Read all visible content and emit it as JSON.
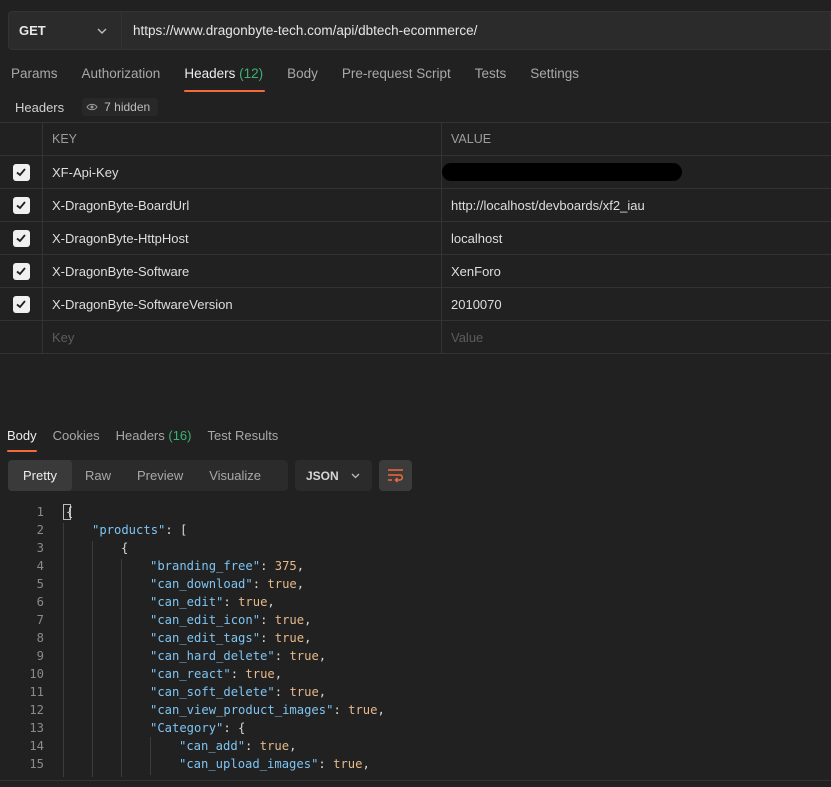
{
  "request": {
    "method": "GET",
    "url": "https://www.dragonbyte-tech.com/api/dbtech-ecommerce/"
  },
  "request_tabs": [
    {
      "label": "Params",
      "count": ""
    },
    {
      "label": "Authorization",
      "count": ""
    },
    {
      "label": "Headers",
      "count": "(12)"
    },
    {
      "label": "Body",
      "count": ""
    },
    {
      "label": "Pre-request Script",
      "count": ""
    },
    {
      "label": "Tests",
      "count": ""
    },
    {
      "label": "Settings",
      "count": ""
    }
  ],
  "headers_panel": {
    "label": "Headers",
    "hidden_label": "7 hidden",
    "col_key": "KEY",
    "col_value": "VALUE",
    "rows": [
      {
        "key": "XF-Api-Key",
        "value": ""
      },
      {
        "key": "X-DragonByte-BoardUrl",
        "value": "http://localhost/devboards/xf2_iau"
      },
      {
        "key": "X-DragonByte-HttpHost",
        "value": "localhost"
      },
      {
        "key": "X-DragonByte-Software",
        "value": "XenForo"
      },
      {
        "key": "X-DragonByte-SoftwareVersion",
        "value": "2010070"
      }
    ],
    "placeholder_key": "Key",
    "placeholder_value": "Value"
  },
  "response_tabs": [
    {
      "label": "Body",
      "count": ""
    },
    {
      "label": "Cookies",
      "count": ""
    },
    {
      "label": "Headers",
      "count": "(16)"
    },
    {
      "label": "Test Results",
      "count": ""
    }
  ],
  "view_modes": [
    "Pretty",
    "Raw",
    "Preview",
    "Visualize"
  ],
  "format": "JSON",
  "code_lines": [
    {
      "n": "1",
      "indent": 0,
      "parts": [
        [
          "p",
          "{"
        ]
      ]
    },
    {
      "n": "2",
      "indent": 1,
      "parts": [
        [
          "k",
          "\"products\""
        ],
        [
          "p",
          ": ["
        ]
      ]
    },
    {
      "n": "3",
      "indent": 2,
      "parts": [
        [
          "p",
          "{"
        ]
      ]
    },
    {
      "n": "4",
      "indent": 3,
      "parts": [
        [
          "k",
          "\"branding_free\""
        ],
        [
          "p",
          ": "
        ],
        [
          "v",
          "375"
        ],
        [
          "p",
          ","
        ]
      ]
    },
    {
      "n": "5",
      "indent": 3,
      "parts": [
        [
          "k",
          "\"can_download\""
        ],
        [
          "p",
          ": "
        ],
        [
          "v",
          "true"
        ],
        [
          "p",
          ","
        ]
      ]
    },
    {
      "n": "6",
      "indent": 3,
      "parts": [
        [
          "k",
          "\"can_edit\""
        ],
        [
          "p",
          ": "
        ],
        [
          "v",
          "true"
        ],
        [
          "p",
          ","
        ]
      ]
    },
    {
      "n": "7",
      "indent": 3,
      "parts": [
        [
          "k",
          "\"can_edit_icon\""
        ],
        [
          "p",
          ": "
        ],
        [
          "v",
          "true"
        ],
        [
          "p",
          ","
        ]
      ]
    },
    {
      "n": "8",
      "indent": 3,
      "parts": [
        [
          "k",
          "\"can_edit_tags\""
        ],
        [
          "p",
          ": "
        ],
        [
          "v",
          "true"
        ],
        [
          "p",
          ","
        ]
      ]
    },
    {
      "n": "9",
      "indent": 3,
      "parts": [
        [
          "k",
          "\"can_hard_delete\""
        ],
        [
          "p",
          ": "
        ],
        [
          "v",
          "true"
        ],
        [
          "p",
          ","
        ]
      ]
    },
    {
      "n": "10",
      "indent": 3,
      "parts": [
        [
          "k",
          "\"can_react\""
        ],
        [
          "p",
          ": "
        ],
        [
          "v",
          "true"
        ],
        [
          "p",
          ","
        ]
      ]
    },
    {
      "n": "11",
      "indent": 3,
      "parts": [
        [
          "k",
          "\"can_soft_delete\""
        ],
        [
          "p",
          ": "
        ],
        [
          "v",
          "true"
        ],
        [
          "p",
          ","
        ]
      ]
    },
    {
      "n": "12",
      "indent": 3,
      "parts": [
        [
          "k",
          "\"can_view_product_images\""
        ],
        [
          "p",
          ": "
        ],
        [
          "v",
          "true"
        ],
        [
          "p",
          ","
        ]
      ]
    },
    {
      "n": "13",
      "indent": 3,
      "parts": [
        [
          "k",
          "\"Category\""
        ],
        [
          "p",
          ": {"
        ]
      ]
    },
    {
      "n": "14",
      "indent": 4,
      "parts": [
        [
          "k",
          "\"can_add\""
        ],
        [
          "p",
          ": "
        ],
        [
          "v",
          "true"
        ],
        [
          "p",
          ","
        ]
      ]
    },
    {
      "n": "15",
      "indent": 4,
      "parts": [
        [
          "k",
          "\"can_upload_images\""
        ],
        [
          "p",
          ": "
        ],
        [
          "v",
          "true"
        ],
        [
          "p",
          ","
        ]
      ]
    }
  ],
  "colors": {
    "accent": "#f26b3a",
    "count_green": "#3bb273",
    "json_key": "#7ec4f2",
    "json_value": "#e6b98a"
  },
  "icons": {
    "method_dropdown": "chevron-down-icon",
    "hidden": "eye-icon",
    "checkbox": "checkmark-icon",
    "format_dropdown": "chevron-down-icon",
    "wrap": "wrap-lines-icon"
  }
}
